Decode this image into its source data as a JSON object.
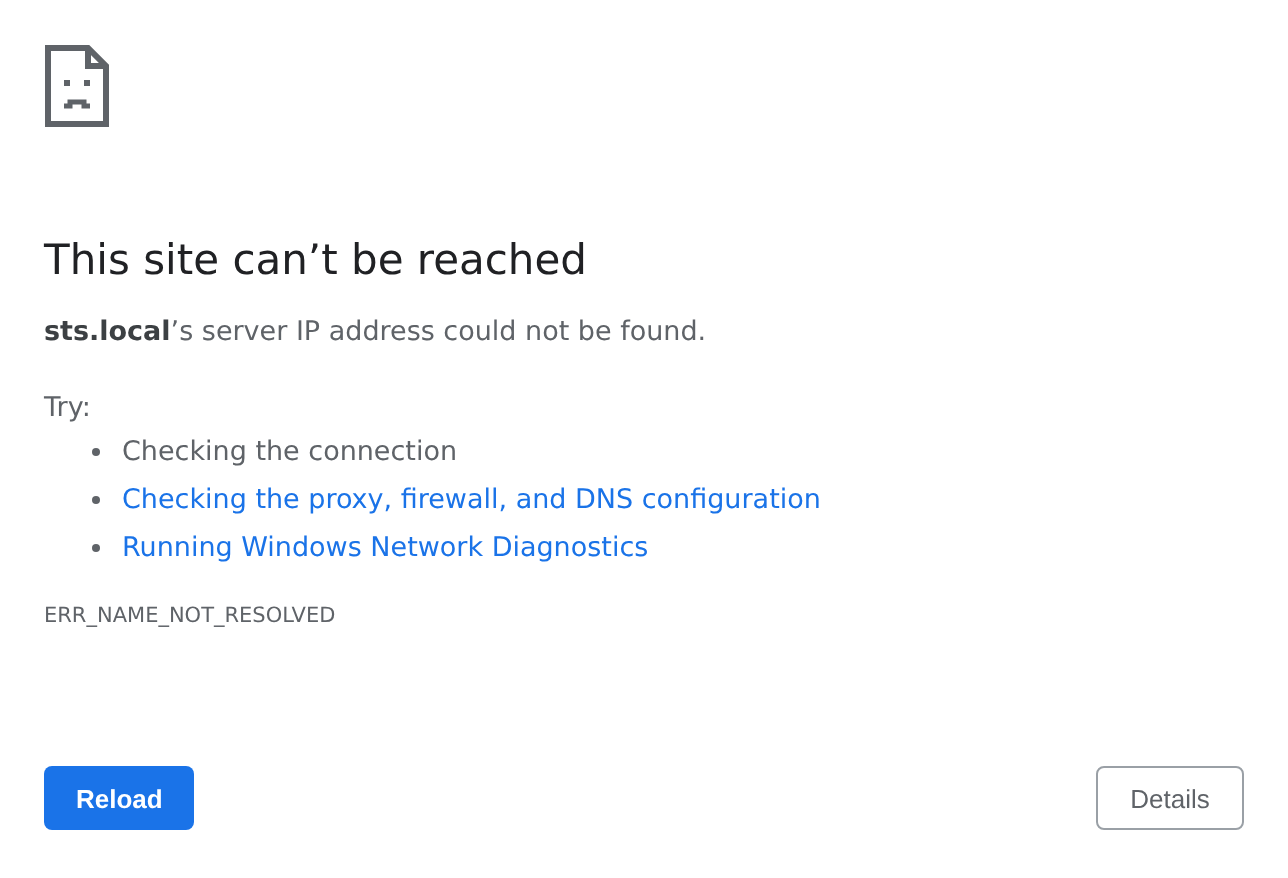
{
  "heading": "This site can’t be reached",
  "message": "**sts.local**’s server IP address could not be found.",
  "suggestions": {
    "label": "Try:",
    "items": [
      {
        "kind": "text",
        "text": "Checking the connection"
      },
      {
        "kind": "link",
        "text": "Checking the proxy, firewall, and DNS configuration"
      },
      {
        "kind": "link",
        "text": "Running Windows Network Diagnostics"
      }
    ]
  },
  "error_code": "ERR_NAME_NOT_RESOLVED",
  "buttons": [
    {
      "kind": "primary",
      "label": "Reload"
    },
    {
      "kind": "secondary",
      "label": "Details"
    }
  ]
}
